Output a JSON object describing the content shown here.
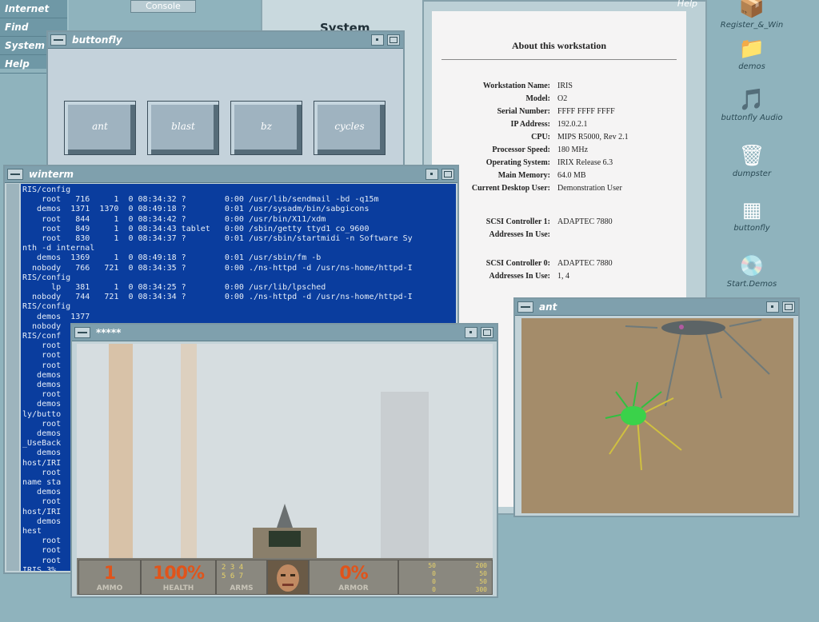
{
  "toolchest": {
    "items": [
      "Internet",
      "Find",
      "System",
      "Help"
    ]
  },
  "console_button": "Console",
  "system_panel": {
    "title": "System"
  },
  "about": {
    "help": "Help",
    "header": "About this workstation",
    "rows": [
      {
        "label": "Workstation Name:",
        "value": "IRIS"
      },
      {
        "label": "Model:",
        "value": "O2"
      },
      {
        "label": "Serial Number:",
        "value": "FFFF FFFF FFFF"
      },
      {
        "label": "IP Address:",
        "value": "192.0.2.1"
      },
      {
        "label": "CPU:",
        "value": "MIPS R5000, Rev 2.1"
      },
      {
        "label": "Processor Speed:",
        "value": "180 MHz"
      },
      {
        "label": "Operating System:",
        "value": "IRIX Release 6.3"
      },
      {
        "label": "Main Memory:",
        "value": "64.0 MB"
      },
      {
        "label": "Current Desktop User:",
        "value": "Demonstration User"
      },
      {
        "label": "SCSI Controller 1:",
        "value": "ADAPTEC 7880"
      },
      {
        "label": "Addresses In Use:",
        "value": ""
      },
      {
        "label": "SCSI Controller 0:",
        "value": "ADAPTEC 7880"
      },
      {
        "label": "Addresses In Use:",
        "value": "1, 4"
      }
    ]
  },
  "buttonfly": {
    "title": "buttonfly",
    "buttons": [
      "ant",
      "blast",
      "bz",
      "cycles"
    ]
  },
  "winterm": {
    "title": "winterm",
    "lines": [
      "RIS/config",
      "    root   716     1  0 08:34:32 ?        0:00 /usr/lib/sendmail -bd -q15m",
      "   demos  1371  1370  0 08:49:18 ?        0:01 /usr/sysadm/bin/sabgicons",
      "    root   844     1  0 08:34:42 ?        0:00 /usr/bin/X11/xdm",
      "    root   849     1  0 08:34:43 tablet   0:00 /sbin/getty ttyd1 co_9600",
      "    root   830     1  0 08:34:37 ?        0:01 /usr/sbin/startmidi -n Software Sy",
      "nth -d internal",
      "   demos  1369     1  0 08:49:18 ?        0:01 /usr/sbin/fm -b",
      "  nobody   766   721  0 08:34:35 ?        0:00 ./ns-httpd -d /usr/ns-home/httpd-I",
      "RIS/config",
      "      lp   381     1  0 08:34:25 ?        0:00 /usr/lib/lpsched",
      "  nobody   744   721  0 08:34:34 ?        0:00 ./ns-httpd -d /usr/ns-home/httpd-I",
      "RIS/config",
      "   demos  1377",
      "  nobody",
      "RIS/conf",
      "    root",
      "    root",
      "    root",
      "   demos",
      "   demos",
      "    root",
      "   demos",
      "ly/butto",
      "    root",
      "   demos",
      "_UseBack",
      "   demos",
      "host/IRI",
      "    root",
      "name sta",
      "   demos",
      "    root",
      "host/IRI",
      "   demos",
      "hest",
      "    root",
      "    root",
      "    root",
      "IRIS 3%"
    ]
  },
  "doom": {
    "title": "*****",
    "ammo": "1",
    "ammo_label": "AMMO",
    "health": "100%",
    "health_label": "HEALTH",
    "arms_label": "ARMS",
    "arms": [
      "2",
      "3",
      "4",
      "5",
      "6",
      "7"
    ],
    "armor": "0%",
    "armor_label": "ARMOR",
    "stats_left": [
      "50",
      "0",
      "0",
      "0"
    ],
    "stats_right": [
      "200",
      "50",
      "50",
      "300"
    ]
  },
  "ant_window": {
    "title": "ant"
  },
  "desktop_icons": [
    {
      "label": "Register_&_Win",
      "glyph": "📦"
    },
    {
      "label": "demos",
      "glyph": "📁"
    },
    {
      "label": "buttonfly Audio",
      "glyph": "🎵"
    },
    {
      "label": "dumpster",
      "glyph": "🗑"
    },
    {
      "label": "buttonfly",
      "glyph": "▦"
    },
    {
      "label": "Start.Demos",
      "glyph": "💿"
    }
  ],
  "colors": {
    "terminal_bg": "#0a3d9e",
    "desktop_bg": "#8fb3bd",
    "hud_red": "#e0541b"
  }
}
